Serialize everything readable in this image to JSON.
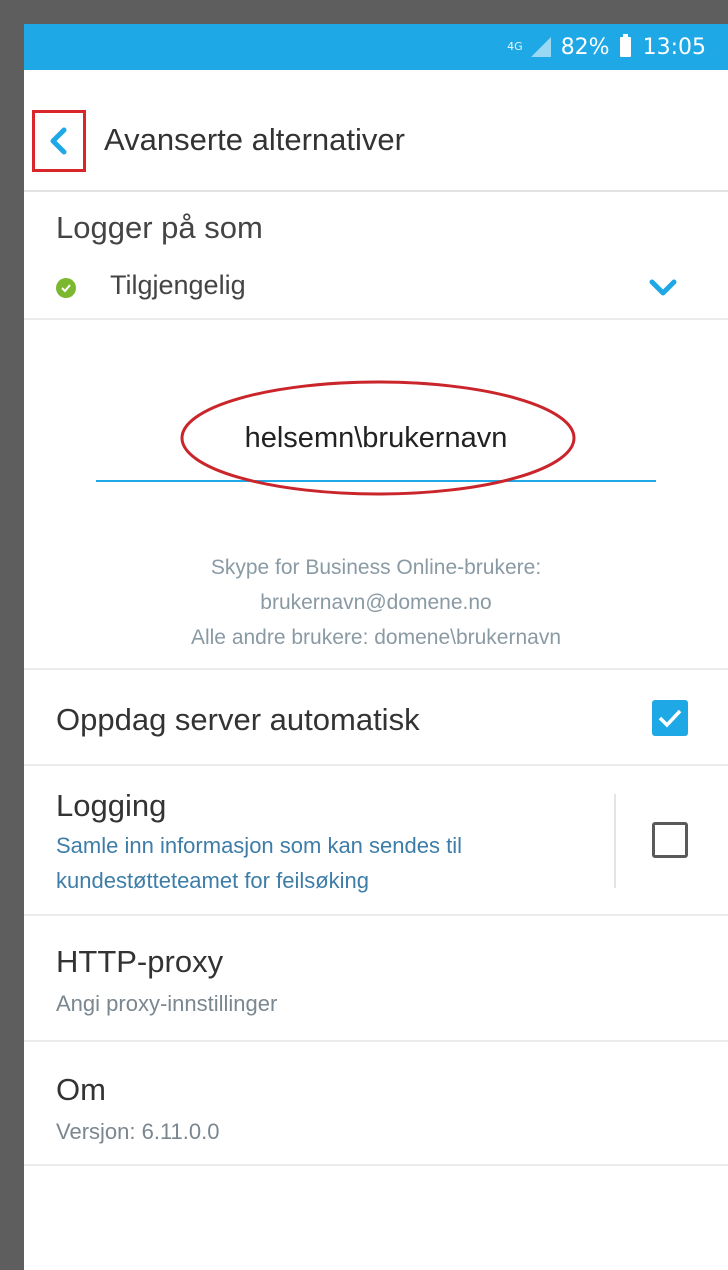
{
  "status_bar": {
    "network": "4G",
    "battery": "82%",
    "time": "13:05"
  },
  "header": {
    "title": "Avanserte alternativer"
  },
  "logger": {
    "label": "Logger på som",
    "presence": "Tilgjengelig",
    "presence_color": "#7cb82f"
  },
  "username": {
    "value": "helsemn\\brukernavn",
    "hint_line1": "Skype for Business Online-brukere:",
    "hint_line2": "brukernavn@domene.no",
    "hint_line3": "Alle andre brukere: domene\\brukernavn"
  },
  "options": {
    "discover": {
      "title": "Oppdag server automatisk",
      "checked": true
    },
    "logging": {
      "title": "Logging",
      "subtitle_line1": "Samle inn informasjon som kan sendes til",
      "subtitle_line2": "kundestøtteteamet for feilsøking",
      "checked": false
    },
    "proxy": {
      "title": "HTTP-proxy",
      "subtitle": "Angi proxy-innstillinger"
    },
    "about": {
      "title": "Om",
      "subtitle": "Versjon: 6.11.0.0"
    }
  },
  "colors": {
    "accent": "#1fa8e6",
    "annotation_red": "#d9262b"
  }
}
